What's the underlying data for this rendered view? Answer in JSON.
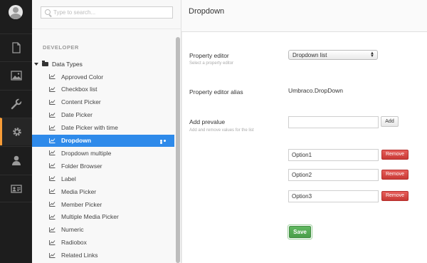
{
  "appbar": {
    "avatar_icon": "user-avatar-icon",
    "sections": [
      {
        "icon": "content-icon"
      },
      {
        "icon": "media-icon"
      },
      {
        "icon": "settings-wrench-icon"
      },
      {
        "icon": "developer-gear-icon",
        "active": true
      },
      {
        "icon": "users-icon"
      },
      {
        "icon": "members-icon"
      }
    ],
    "accent_color": "#f79c37"
  },
  "tree": {
    "search_placeholder": "Type to search...",
    "section_label": "DEVELOPER",
    "root_label": "Data Types",
    "items": [
      {
        "label": "Approved Color"
      },
      {
        "label": "Checkbox list"
      },
      {
        "label": "Content Picker"
      },
      {
        "label": "Date Picker"
      },
      {
        "label": "Date Picker with time"
      },
      {
        "label": "Dropdown",
        "selected": true
      },
      {
        "label": "Dropdown multiple"
      },
      {
        "label": "Folder Browser"
      },
      {
        "label": "Label"
      },
      {
        "label": "Media Picker"
      },
      {
        "label": "Member Picker"
      },
      {
        "label": "Multiple Media Picker"
      },
      {
        "label": "Numeric"
      },
      {
        "label": "Radiobox"
      },
      {
        "label": "Related Links"
      }
    ],
    "selected_color": "#2e8aea"
  },
  "editor": {
    "title": "Dropdown",
    "property_editor": {
      "label": "Property editor",
      "description": "Select a property editor",
      "selected_value": "Dropdown list"
    },
    "alias": {
      "label": "Property editor alias",
      "value": "Umbraco.DropDown"
    },
    "prevalue": {
      "label": "Add prevalue",
      "description": "Add and remove values for the list",
      "input_value": "",
      "add_label": "Add",
      "options": [
        {
          "value": "Option1",
          "remove_label": "Remove"
        },
        {
          "value": "Option2",
          "remove_label": "Remove"
        },
        {
          "value": "Option3",
          "remove_label": "Remove"
        }
      ]
    },
    "save_label": "Save"
  }
}
